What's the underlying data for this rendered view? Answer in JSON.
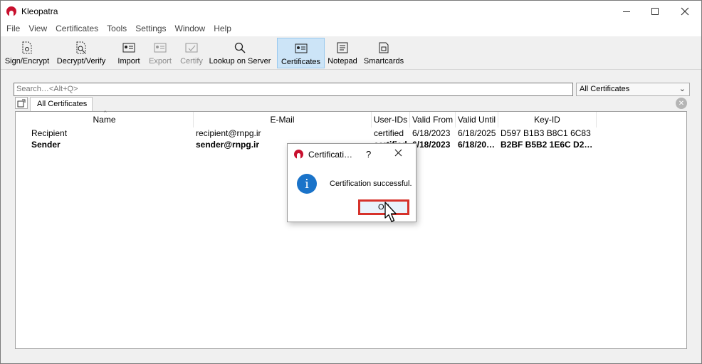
{
  "window": {
    "title": "Kleopatra"
  },
  "menu": [
    "File",
    "View",
    "Certificates",
    "Tools",
    "Settings",
    "Window",
    "Help"
  ],
  "toolbar": {
    "sign_encrypt": "Sign/Encrypt",
    "decrypt_verify": "Decrypt/Verify",
    "import": "Import",
    "export": "Export",
    "certify": "Certify",
    "lookup": "Lookup on Server",
    "certificates": "Certificates",
    "notepad": "Notepad",
    "smartcards": "Smartcards"
  },
  "search": {
    "placeholder": "Search…<Alt+Q>"
  },
  "filter": {
    "selected": "All Certificates"
  },
  "tabs": {
    "active": "All Certificates"
  },
  "table": {
    "columns": [
      "Name",
      "E-Mail",
      "User-IDs",
      "Valid From",
      "Valid Until",
      "Key-ID"
    ],
    "rows": [
      {
        "name": "Recipient",
        "email": "recipient@rnpg.ir",
        "user_ids": "certified",
        "valid_from": "6/18/2023",
        "valid_until": "6/18/2025",
        "key_id": "D597 B1B3 B8C1 6C83",
        "bold": false
      },
      {
        "name": "Sender",
        "email": "sender@rnpg.ir",
        "user_ids": "certified",
        "valid_from": "6/18/2023",
        "valid_until": "6/18/20…",
        "key_id": "B2BF B5B2 1E6C D2…",
        "bold": true
      }
    ]
  },
  "dialog": {
    "title": "Certificati…",
    "help": "?",
    "message": "Certification successful.",
    "ok_label": "OK"
  },
  "colors": {
    "accent": "#1a73c9",
    "highlight": "#d6322b",
    "brand": "#c8102e"
  }
}
